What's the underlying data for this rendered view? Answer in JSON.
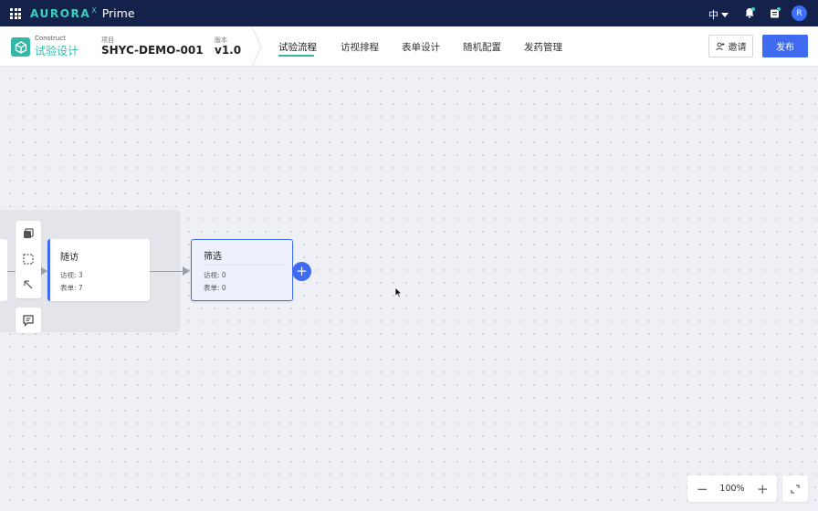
{
  "topbar": {
    "brand_name": "AURORA",
    "brand_superscript": "X",
    "product": "Prime",
    "language": "中",
    "avatar_initial": "R"
  },
  "header": {
    "module_small": "Construct",
    "module_title": "试验设计",
    "project_label": "项目",
    "project_value": "SHYC-DEMO-001",
    "version_label": "版本",
    "version_value": "v1.0",
    "tabs": [
      {
        "label": "试验流程",
        "active": true
      },
      {
        "label": "访视排程",
        "active": false
      },
      {
        "label": "表单设计",
        "active": false
      },
      {
        "label": "随机配置",
        "active": false
      },
      {
        "label": "发药管理",
        "active": false
      }
    ],
    "invite_label": "邀请",
    "publish_label": "发布"
  },
  "canvas": {
    "nodes": [
      {
        "title": "随访",
        "visits": "访视: 3",
        "forms": "表单: 7"
      },
      {
        "title": "筛选",
        "visits": "访视: 0",
        "forms": "表单: 0"
      }
    ],
    "add_symbol": "+"
  },
  "zoom": {
    "minus": "−",
    "value": "100%",
    "plus": "+"
  },
  "colors": {
    "accent": "#3e6bf0",
    "brand": "#32b7a6",
    "topbar": "#14224b"
  }
}
